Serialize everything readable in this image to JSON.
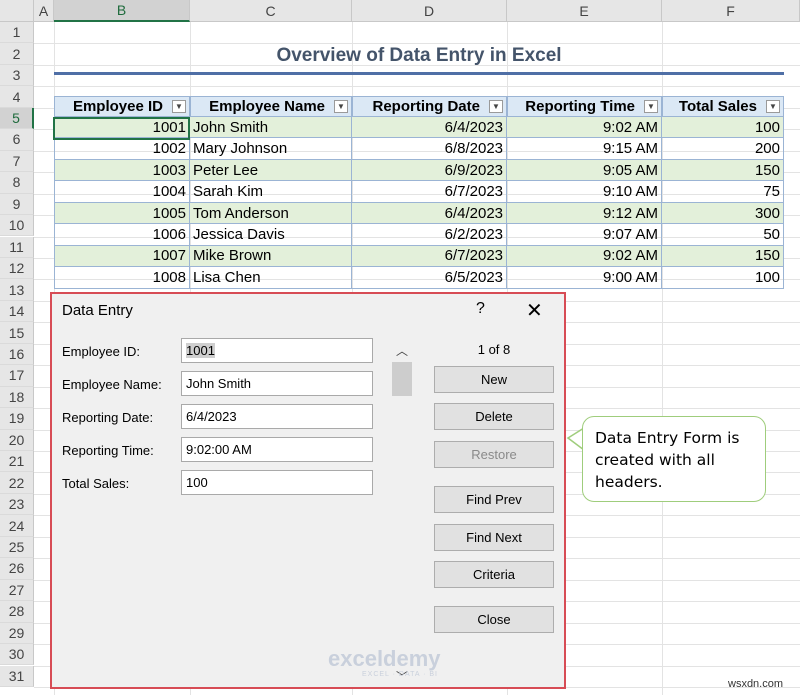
{
  "sheet": {
    "columns": [
      "A",
      "B",
      "C",
      "D",
      "E",
      "F"
    ],
    "rows": [
      "1",
      "2",
      "3",
      "4",
      "5",
      "6",
      "7",
      "8",
      "9",
      "10",
      "11",
      "12",
      "13",
      "14",
      "15",
      "16",
      "17",
      "18",
      "19",
      "20",
      "21",
      "22",
      "23",
      "24",
      "25",
      "26",
      "27",
      "28",
      "29",
      "30",
      "31"
    ],
    "title": "Overview of Data Entry in Excel",
    "headers": [
      "Employee ID",
      "Employee Name",
      "Reporting Date",
      "Reporting Time",
      "Total Sales"
    ],
    "records": [
      [
        "1001",
        "John Smith",
        "6/4/2023",
        "9:02 AM",
        "100"
      ],
      [
        "1002",
        "Mary Johnson",
        "6/8/2023",
        "9:15 AM",
        "200"
      ],
      [
        "1003",
        "Peter Lee",
        "6/9/2023",
        "9:05 AM",
        "150"
      ],
      [
        "1004",
        "Sarah Kim",
        "6/7/2023",
        "9:10 AM",
        "75"
      ],
      [
        "1005",
        "Tom Anderson",
        "6/4/2023",
        "9:12 AM",
        "300"
      ],
      [
        "1006",
        "Jessica Davis",
        "6/2/2023",
        "9:07 AM",
        "50"
      ],
      [
        "1007",
        "Mike Brown",
        "6/7/2023",
        "9:02 AM",
        "150"
      ],
      [
        "1008",
        "Lisa Chen",
        "6/5/2023",
        "9:00 AM",
        "100"
      ]
    ],
    "band_color": "#e3f0da",
    "header_fill": "#dbe8f5"
  },
  "dialog": {
    "title": "Data Entry",
    "help": "?",
    "close_glyph": "✕",
    "fields": [
      {
        "label": "Employee ID:",
        "value": "1001"
      },
      {
        "label": "Employee Name:",
        "value": "John Smith"
      },
      {
        "label": "Reporting Date:",
        "value": "6/4/2023"
      },
      {
        "label": "Reporting Time:",
        "value": "9:02:00 AM"
      },
      {
        "label": "Total Sales:",
        "value": "100"
      }
    ],
    "counter": "1 of 8",
    "buttons": {
      "new": "New",
      "delete": "Delete",
      "restore": "Restore",
      "find_prev": "Find Prev",
      "find_next": "Find Next",
      "criteria": "Criteria",
      "close": "Close"
    },
    "border_color": "#d74c55"
  },
  "watermark": {
    "name": "exceldemy",
    "tagline": "EXCEL · DATA · BI"
  },
  "callout": {
    "text": "Data Entry Form is created with all headers."
  },
  "footer": "wsxdn.com"
}
